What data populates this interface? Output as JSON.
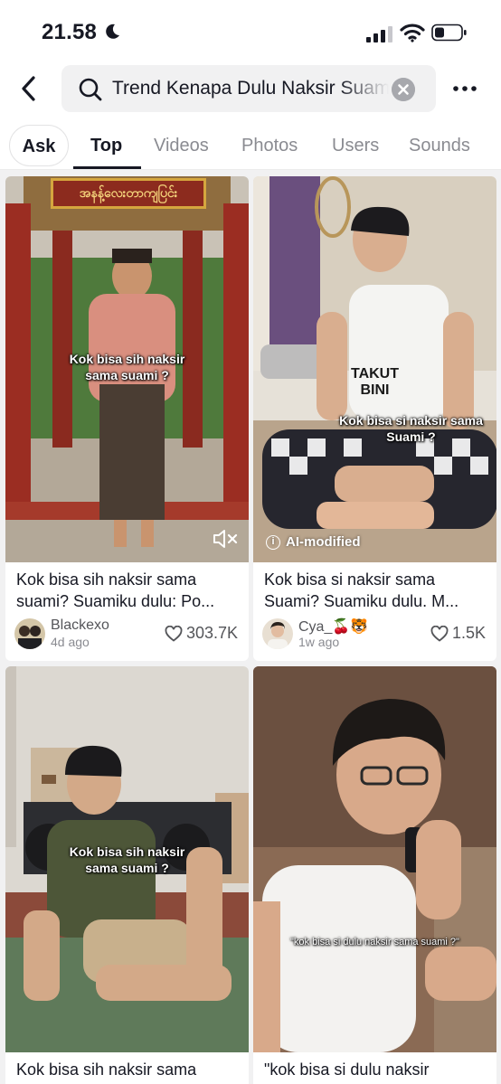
{
  "status_bar": {
    "time": "21.58",
    "icons": [
      "moon-icon",
      "signal-icon",
      "wifi-icon",
      "battery-icon"
    ]
  },
  "search": {
    "query": "Trend Kenapa Dulu Naksir Suami"
  },
  "tabs": [
    {
      "label": "Ask",
      "active": false
    },
    {
      "label": "Top",
      "active": true
    },
    {
      "label": "Videos",
      "active": false
    },
    {
      "label": "Photos",
      "active": false
    },
    {
      "label": "Users",
      "active": false
    },
    {
      "label": "Sounds",
      "active": false
    }
  ],
  "colors": {
    "text_primary": "#161823",
    "text_secondary": "#8a8b91",
    "grid_background": "#f1f1f2",
    "searchbox_background": "#f1f1f2"
  },
  "results": [
    {
      "sign_text": "အနန့်လေးတာကျပြင်း",
      "overlay": "Kok bisa sih naksir sama suami ?",
      "title": "Kok bisa sih naksir sama suami? Suamiku dulu: Po...",
      "author": "Blackexo",
      "date": "4d ago",
      "likes": "303.7K",
      "muted_icon": "mute-icon"
    },
    {
      "overlay": "Kok bisa si naksir sama Suami ?",
      "shirt_text": "TAKUT BINI",
      "badge": "AI-modified",
      "title": "Kok bisa si naksir sama Suami? Suamiku dulu. M...",
      "author": "Cya_🍒🐯",
      "date": "1w ago",
      "likes": "1.5K"
    },
    {
      "overlay": "Kok bisa sih naksir sama suami ?",
      "title": "Kok bisa sih naksir sama"
    },
    {
      "overlay": "\"kok bisa si dulu naksir  sama suami ?\"",
      "title": "\"kok bisa si dulu naksir"
    }
  ]
}
